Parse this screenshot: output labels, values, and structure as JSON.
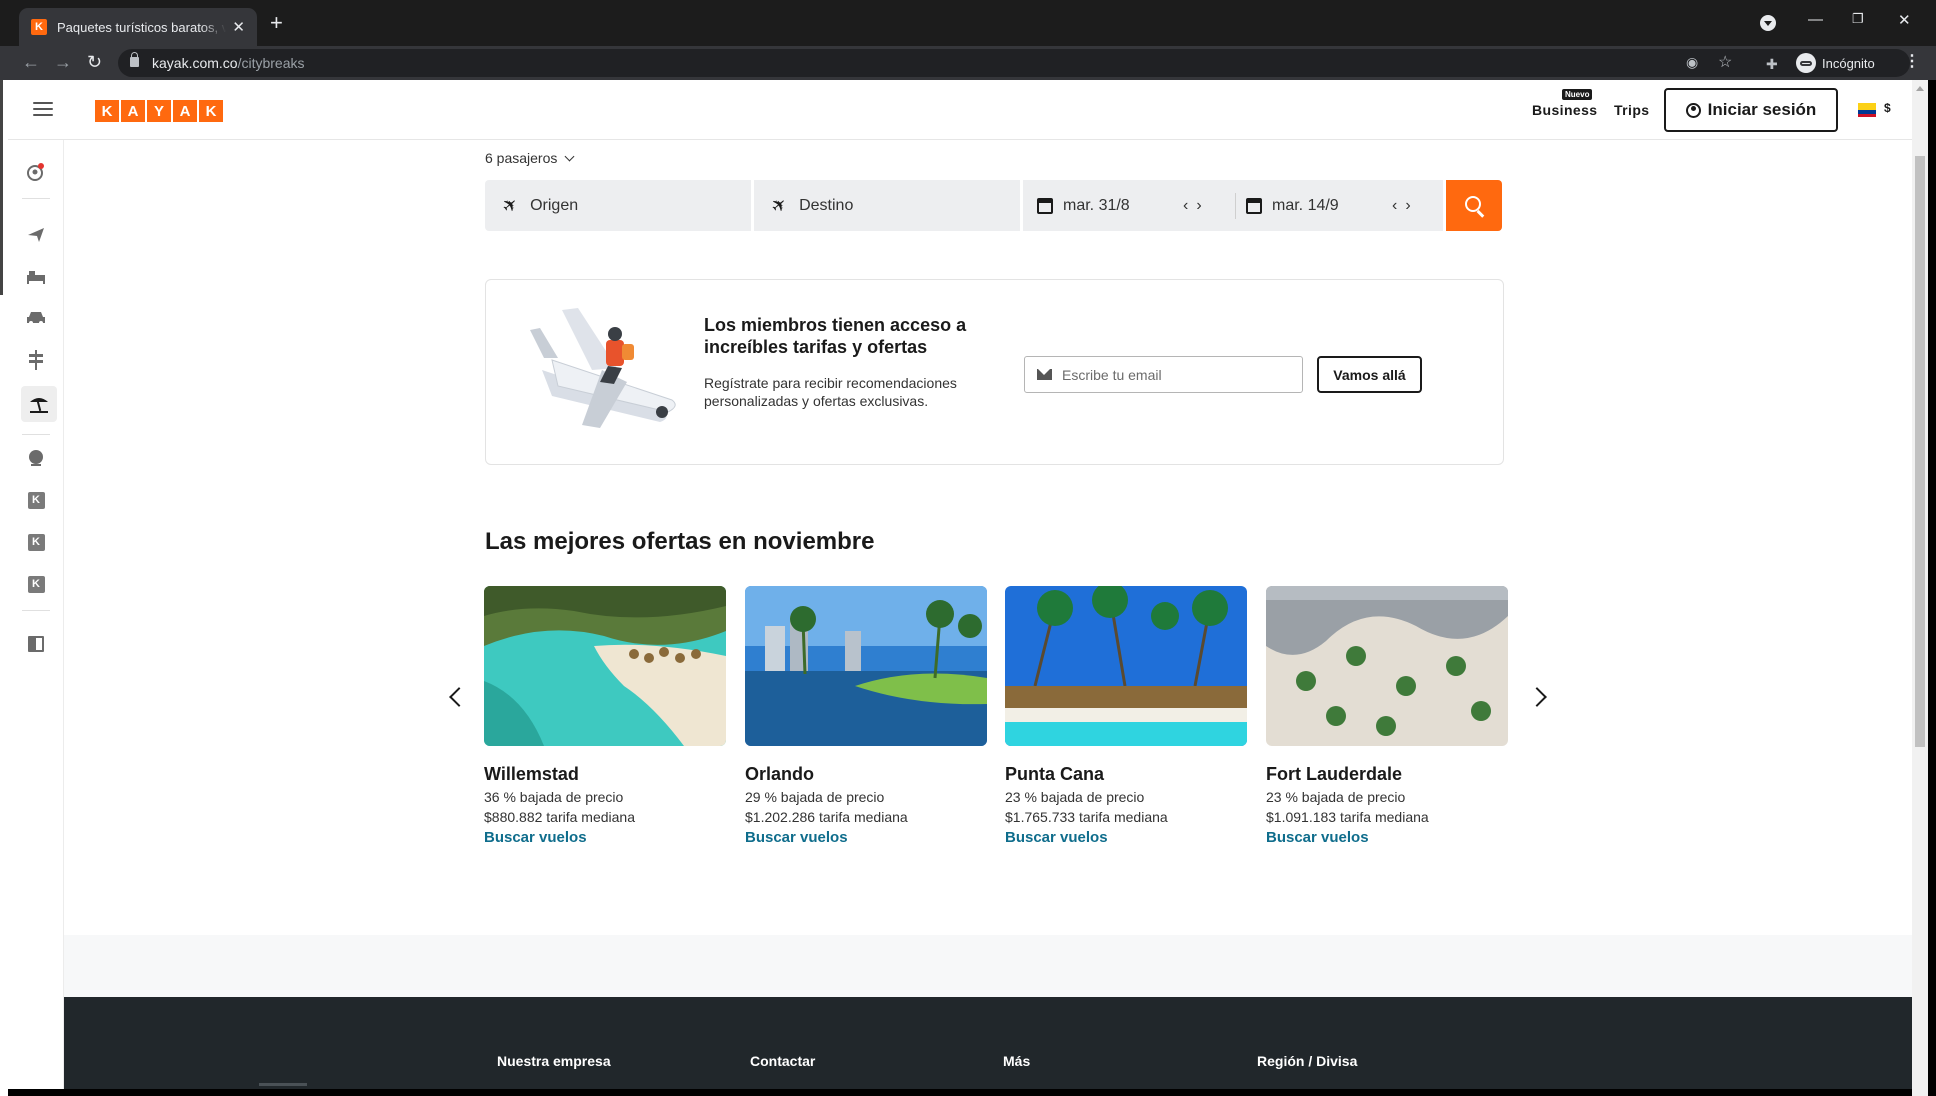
{
  "browser": {
    "tab_title": "Paquetes turísticos baratos, vuelos",
    "favicon_letter": "K",
    "url_host": "kayak.com.co",
    "url_path": "/citybreaks",
    "profile_label": "Incógnito"
  },
  "header": {
    "logo_letters": [
      "K",
      "A",
      "Y",
      "A",
      "K"
    ],
    "business_label": "Business",
    "business_badge": "Nuevo",
    "trips_label": "Trips",
    "signin_label": "Iniciar sesión",
    "currency": "$"
  },
  "sidebar": {
    "items": [
      {
        "name": "notifications-icon"
      },
      {
        "name": "flights-icon"
      },
      {
        "name": "hotels-icon"
      },
      {
        "name": "cars-icon"
      },
      {
        "name": "explore-icon"
      },
      {
        "name": "packages-icon",
        "active": true
      },
      {
        "name": "travel-restrictions-icon"
      },
      {
        "name": "kayak-app-icon"
      },
      {
        "name": "kayak-app-icon"
      },
      {
        "name": "kayak-app-icon"
      },
      {
        "name": "guides-icon"
      }
    ],
    "k_letter": "K"
  },
  "search": {
    "passengers": "6 pasajeros",
    "origin_placeholder": "Origen",
    "destination_placeholder": "Destino",
    "depart_date": "mar. 31/8",
    "return_date": "mar. 14/9"
  },
  "member": {
    "title": "Los miembros tienen acceso a increíbles tarifas y ofertas",
    "subtitle": "Regístrate para recibir recomendaciones personalizadas y ofertas exclusivas.",
    "email_placeholder": "Escribe tu email",
    "button_label": "Vamos allá"
  },
  "deals": {
    "title": "Las mejores ofertas en noviembre",
    "cards": [
      {
        "city": "Willemstad",
        "drop": "36 % bajada de precio",
        "price": "$880.882 tarifa mediana",
        "link": "Buscar vuelos"
      },
      {
        "city": "Orlando",
        "drop": "29 % bajada de precio",
        "price": "$1.202.286 tarifa mediana",
        "link": "Buscar vuelos"
      },
      {
        "city": "Punta Cana",
        "drop": "23 % bajada de precio",
        "price": "$1.765.733 tarifa mediana",
        "link": "Buscar vuelos"
      },
      {
        "city": "Fort Lauderdale",
        "drop": "23 % bajada de precio",
        "price": "$1.091.183 tarifa mediana",
        "link": "Buscar vuelos"
      }
    ]
  },
  "footer": {
    "columns": [
      "Nuestra empresa",
      "Contactar",
      "Más",
      "Región / Divisa"
    ]
  },
  "colors": {
    "brand_orange": "#ff690f",
    "link_teal": "#0f6d8c",
    "footer_bg": "#21272b"
  }
}
